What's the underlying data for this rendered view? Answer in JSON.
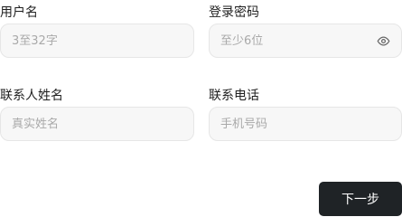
{
  "form": {
    "username": {
      "label": "用户名",
      "value": "",
      "placeholder": "3至32字"
    },
    "password": {
      "label": "登录密码",
      "value": "",
      "placeholder": "至少6位",
      "toggle_icon": "eye-icon"
    },
    "contact_name": {
      "label": "联系人姓名",
      "value": "",
      "placeholder": "真实姓名"
    },
    "contact_phone": {
      "label": "联系电话",
      "value": "",
      "placeholder": "手机号码"
    }
  },
  "actions": {
    "next_label": "下一步"
  },
  "colors": {
    "input_background": "#f7f7f7",
    "input_border": "#e6e6e6",
    "placeholder": "#a9a9a9",
    "button_background": "#1f2326",
    "button_text": "#ffffff"
  }
}
